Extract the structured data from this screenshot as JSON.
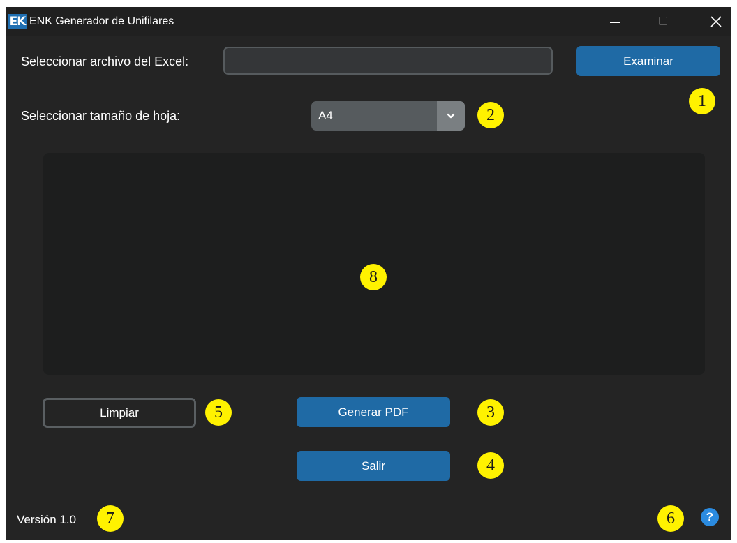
{
  "window": {
    "logo": "EK",
    "title": "ENK Generador de Unifilares"
  },
  "file": {
    "label": "Seleccionar archivo del Excel:",
    "value": "",
    "placeholder": "",
    "browse_label": "Examinar"
  },
  "sheet": {
    "label": "Seleccionar tamaño de hoja:",
    "selected": "A4"
  },
  "log": {
    "text": ""
  },
  "buttons": {
    "clear_label": "Limpiar",
    "generate_label": "Generar PDF",
    "exit_label": "Salir"
  },
  "footer": {
    "version": "Versión 1.0",
    "help_glyph": "?"
  },
  "markers": [
    "1",
    "2",
    "3",
    "4",
    "5",
    "6",
    "7",
    "8"
  ],
  "colors": {
    "accent": "#1f6aa5",
    "marker": "#fff200",
    "help": "#2b8be0",
    "background": "#242424"
  },
  "icons": [
    "app-logo-icon",
    "minimize-icon",
    "maximize-icon",
    "close-icon",
    "chevron-down-icon",
    "help-icon"
  ]
}
